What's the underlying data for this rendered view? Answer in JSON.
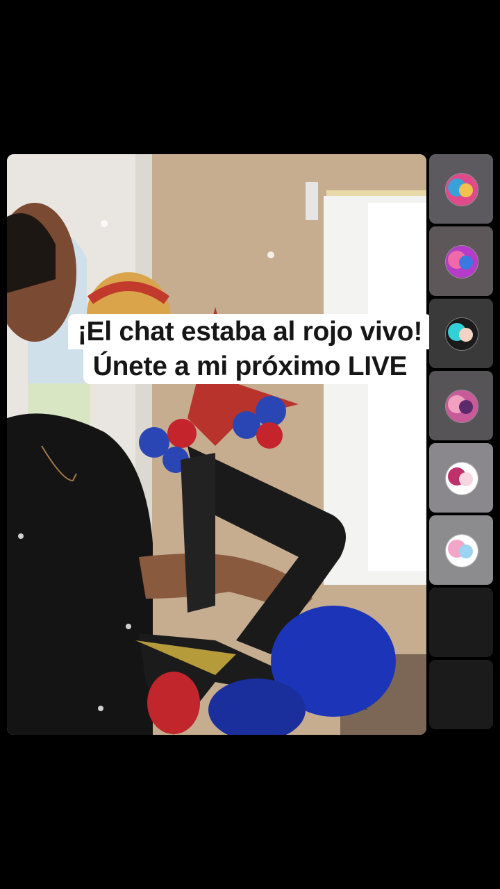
{
  "caption": {
    "line1": "¡El chat estaba al rojo vivo!",
    "line2": "Únete a mi próximo LIVE"
  },
  "guests": [
    {
      "slot": 1,
      "state": "avatar",
      "icon": "guest-avatar-1",
      "bg": "#5c5a5e",
      "avatar_colors": [
        "#e04a8a",
        "#3aa0d8",
        "#f2c14e"
      ]
    },
    {
      "slot": 2,
      "state": "avatar",
      "icon": "guest-avatar-2",
      "bg": "#5d5759",
      "avatar_colors": [
        "#b43cc8",
        "#f06aa8",
        "#3a7ae0"
      ]
    },
    {
      "slot": 3,
      "state": "avatar",
      "icon": "guest-avatar-3",
      "bg": "#3a3a3a",
      "avatar_colors": [
        "#1b1b1b",
        "#33d0d8",
        "#f4d2c4"
      ]
    },
    {
      "slot": 4,
      "state": "avatar",
      "icon": "guest-avatar-4",
      "bg": "#575457",
      "avatar_colors": [
        "#c85a9a",
        "#f2a0c0",
        "#5b2a6a"
      ]
    },
    {
      "slot": 5,
      "state": "avatar",
      "icon": "guest-avatar-betyea",
      "bg": "#8a888c",
      "avatar_colors": [
        "#ffffff",
        "#c0306a",
        "#f6d6e0"
      ]
    },
    {
      "slot": 6,
      "state": "avatar",
      "icon": "guest-avatar-6",
      "bg": "#8c8c8e",
      "avatar_colors": [
        "#ffffff",
        "#f4a6c8",
        "#9ad4f0"
      ]
    },
    {
      "slot": 7,
      "state": "empty",
      "bg": "#1b1b1b"
    },
    {
      "slot": 8,
      "state": "empty",
      "bg": "#1b1b1b"
    }
  ]
}
